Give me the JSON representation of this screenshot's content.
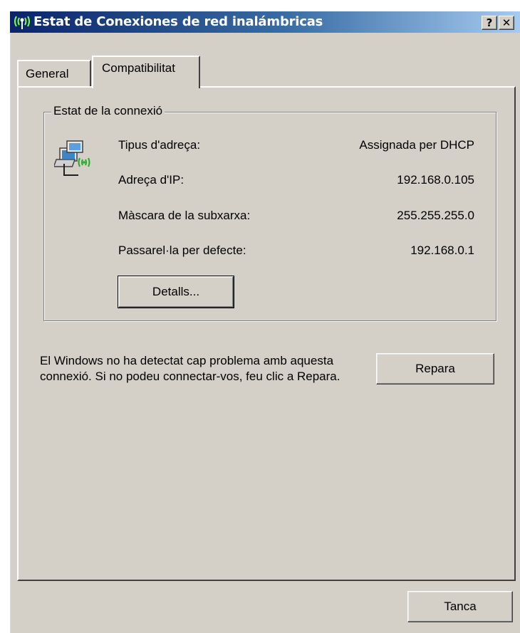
{
  "window": {
    "title": "Estat de Conexiones de red inalámbricas",
    "help_button": "?",
    "close_button": "✕"
  },
  "tabs": [
    {
      "label": "General",
      "active": false
    },
    {
      "label": "Compatibilitat",
      "active": true
    }
  ],
  "connection_status": {
    "group_label": "Estat de la connexió",
    "icon": "wireless-network-icon",
    "rows": [
      {
        "label": "Tipus d'adreça:",
        "value": "Assignada per DHCP"
      },
      {
        "label": "Adreça d'IP:",
        "value": "192.168.0.105"
      },
      {
        "label": "Màscara de la subxarxa:",
        "value": "255.255.255.0"
      },
      {
        "label": "Passarel·la per defecte:",
        "value": "192.168.0.1"
      }
    ],
    "details_button": "Detalls..."
  },
  "repair": {
    "message": "El Windows no ha detectat cap problema amb aquesta connexió. Si no podeu connectar-vos, feu clic a Repara.",
    "button": "Repara"
  },
  "footer": {
    "close_button": "Tanca"
  },
  "colors": {
    "title_gradient_start": "#0a246a",
    "title_gradient_end": "#a6caf0",
    "face": "#d4d0c8"
  }
}
